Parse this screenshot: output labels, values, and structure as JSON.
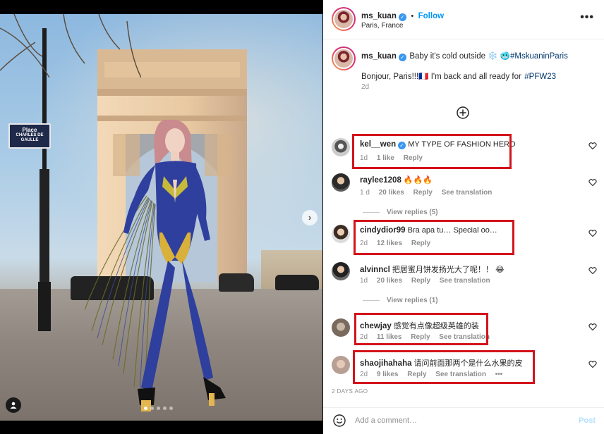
{
  "post": {
    "header": {
      "username": "ms_kuan",
      "follow_label": "Follow",
      "separator": "•",
      "location": "Paris, France",
      "more_icon": "more-horizontal-icon"
    },
    "photo": {
      "sign_line1": "Place",
      "sign_line2": "CHARLES DE GAULLE",
      "carousel_count": 5,
      "carousel_active": 1
    },
    "caption": {
      "username": "ms_kuan",
      "text": "Baby it's cold outside ❄️ 🥶",
      "hashtag": "#MskuaninParis",
      "line2": "Bonjour, Paris!!!🇫🇷 I'm back and all ready for",
      "line2_hashtag": "#PFW23",
      "time": "2d"
    },
    "comments": [
      {
        "username": "kel__wen",
        "verified": true,
        "text": "MY TYPE OF FASHION HERO",
        "time": "1d",
        "likes": "1 like",
        "reply": "Reply",
        "translate": ""
      },
      {
        "username": "raylee1208",
        "verified": false,
        "text": "🔥🔥🔥",
        "time": "1 d",
        "likes": "20 likes",
        "reply": "Reply",
        "translate": "See translation"
      },
      {
        "username": "cindydior99",
        "verified": false,
        "text": "Bra apa tu… Special oo…",
        "time": "2d",
        "likes": "12 likes",
        "reply": "Reply",
        "translate": ""
      },
      {
        "username": "alvinncl",
        "verified": false,
        "text": "把居蜜月饼发扬光大了呢！！ 😂",
        "time": "1d",
        "likes": "20 likes",
        "reply": "Reply",
        "translate": "See translation"
      },
      {
        "username": "chewjay",
        "verified": false,
        "text": "感觉有点像超级英雄的装",
        "time": "2d",
        "likes": "11 likes",
        "reply": "Reply",
        "translate": "See translation"
      },
      {
        "username": "shaojihahaha",
        "verified": false,
        "text": "请问前面那两个是什么水果的皮",
        "time": "2d",
        "likes": "9 likes",
        "reply": "Reply",
        "translate": "See translation",
        "more": "•••"
      }
    ],
    "view_replies_1": "View replies (5)",
    "view_replies_2": "View replies (1)",
    "posted_ago": "2 DAYS AGO",
    "footer": {
      "placeholder": "Add a comment…",
      "post_label": "Post"
    }
  }
}
